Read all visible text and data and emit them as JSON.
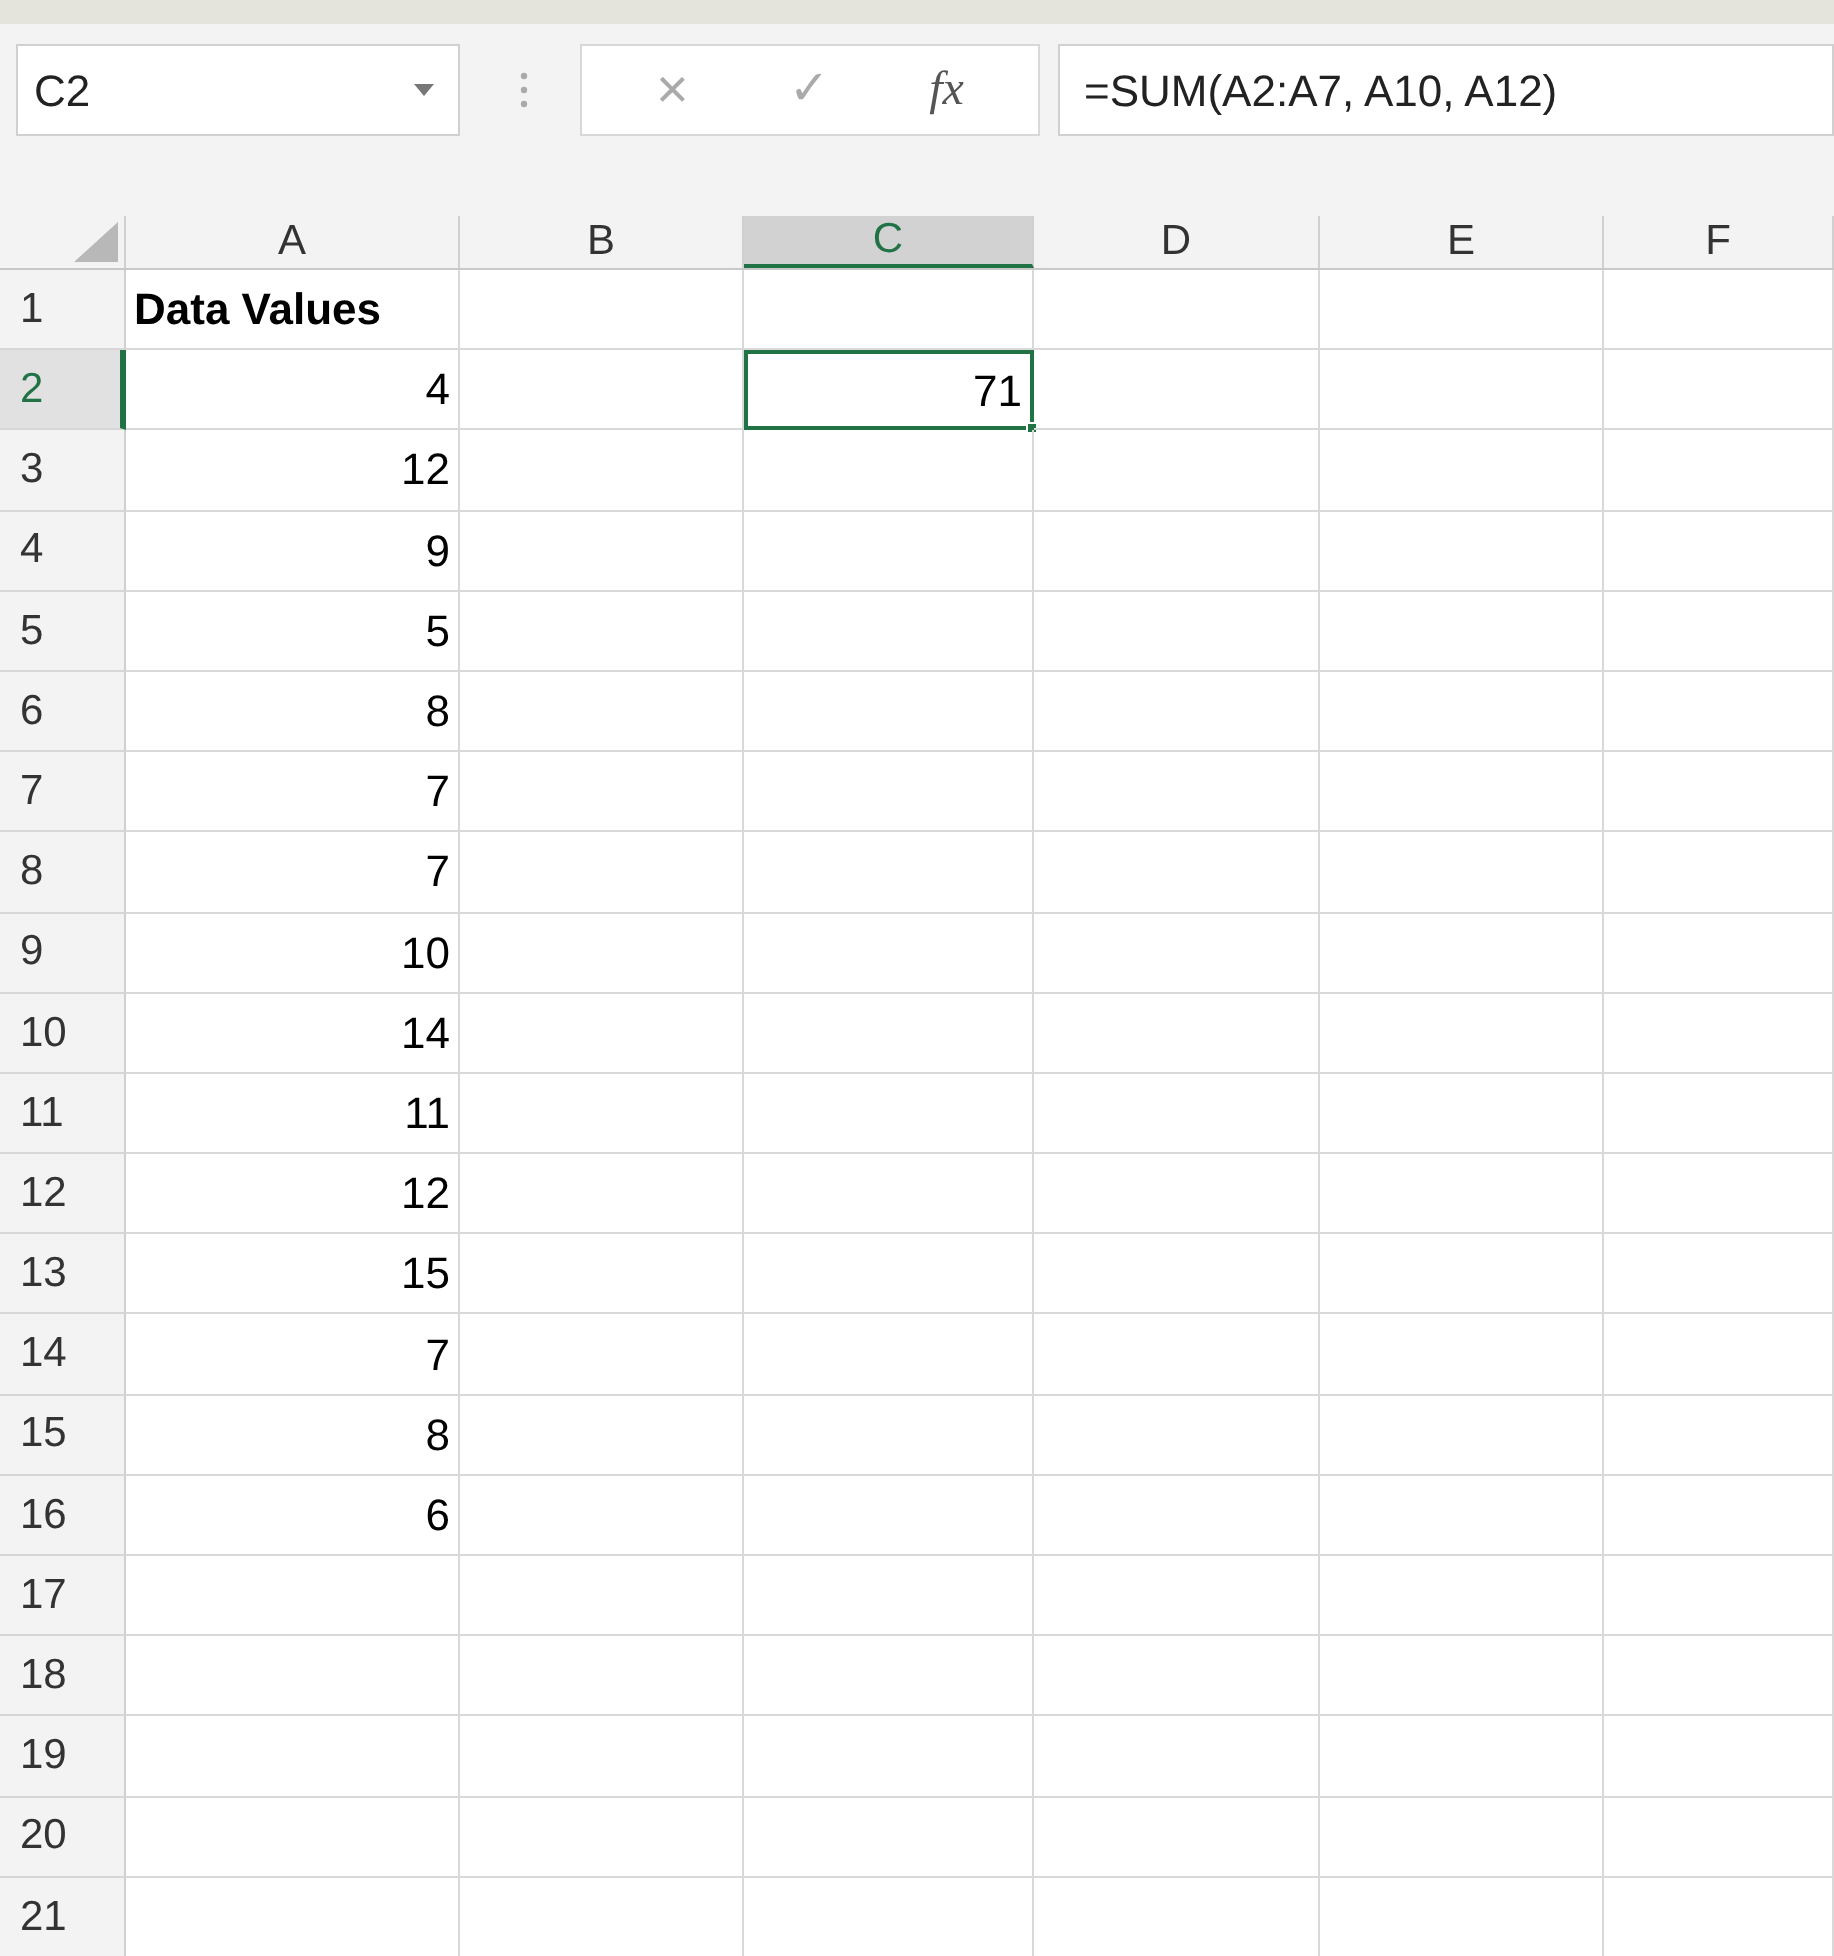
{
  "name_box": {
    "value": "C2"
  },
  "formula_bar": {
    "cancel": "×",
    "enter": "✓",
    "function": "fx",
    "formula": "=SUM(A2:A7, A10, A12)"
  },
  "columns": [
    {
      "label": "A",
      "selected": false
    },
    {
      "label": "B",
      "selected": false
    },
    {
      "label": "C",
      "selected": true
    },
    {
      "label": "D",
      "selected": false
    },
    {
      "label": "E",
      "selected": false
    },
    {
      "label": "F",
      "selected": false
    }
  ],
  "rows": [
    {
      "label": "1",
      "selected": false,
      "a": {
        "value": "Data Values",
        "bold": true
      }
    },
    {
      "label": "2",
      "selected": true,
      "a": {
        "value": "4",
        "bold": false
      },
      "c": {
        "value": "71",
        "selected": true
      }
    },
    {
      "label": "3",
      "selected": false,
      "a": {
        "value": "12",
        "bold": false
      }
    },
    {
      "label": "4",
      "selected": false,
      "a": {
        "value": "9",
        "bold": false
      }
    },
    {
      "label": "5",
      "selected": false,
      "a": {
        "value": "5",
        "bold": false
      }
    },
    {
      "label": "6",
      "selected": false,
      "a": {
        "value": "8",
        "bold": false
      }
    },
    {
      "label": "7",
      "selected": false,
      "a": {
        "value": "7",
        "bold": false
      }
    },
    {
      "label": "8",
      "selected": false,
      "a": {
        "value": "7",
        "bold": false
      }
    },
    {
      "label": "9",
      "selected": false,
      "a": {
        "value": "10",
        "bold": false
      }
    },
    {
      "label": "10",
      "selected": false,
      "a": {
        "value": "14",
        "bold": false
      }
    },
    {
      "label": "11",
      "selected": false,
      "a": {
        "value": "11",
        "bold": false
      }
    },
    {
      "label": "12",
      "selected": false,
      "a": {
        "value": "12",
        "bold": false
      }
    },
    {
      "label": "13",
      "selected": false,
      "a": {
        "value": "15",
        "bold": false
      }
    },
    {
      "label": "14",
      "selected": false,
      "a": {
        "value": "7",
        "bold": false
      }
    },
    {
      "label": "15",
      "selected": false,
      "a": {
        "value": "8",
        "bold": false
      }
    },
    {
      "label": "16",
      "selected": false,
      "a": {
        "value": "6",
        "bold": false
      }
    },
    {
      "label": "17",
      "selected": false
    },
    {
      "label": "18",
      "selected": false
    },
    {
      "label": "19",
      "selected": false
    },
    {
      "label": "20",
      "selected": false
    },
    {
      "label": "21",
      "selected": false
    }
  ]
}
